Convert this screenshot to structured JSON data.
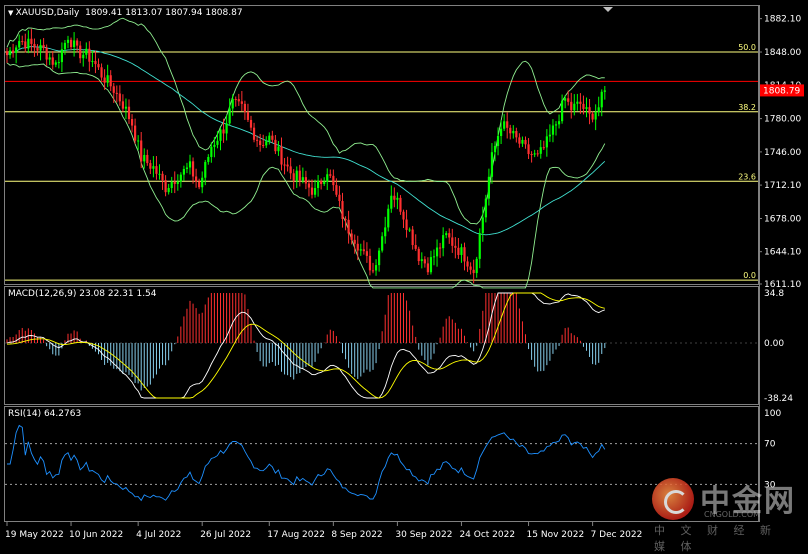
{
  "header": {
    "symbol": "XAUUSD,Daily",
    "ohlc": "1809.41 1813.07 1807.94 1808.87"
  },
  "panels": {
    "macd": {
      "title": "MACD(12,26,9) 23.08 22.31 1.54"
    },
    "rsi": {
      "title": "RSI(14) 64.2763"
    }
  },
  "watermark": {
    "brand": "中金网",
    "site": "CNGOLD.COM",
    "tagline": "中 文 财 经 新 媒 体"
  },
  "colors": {
    "background": "#000000",
    "grid_frame": "#808080",
    "bull_candle": "#00ff00",
    "bear_candle": "#ff3030",
    "bollinger": "#90ee90",
    "ma": "#40e0d0",
    "fib_line": "#ffff80",
    "current_price_line": "#ff0000",
    "macd_hist_pos": "#ff3030",
    "macd_hist_neg": "#87ceeb",
    "macd_line": "#ffffff",
    "signal_line": "#ffff00",
    "rsi_line": "#1e90ff"
  },
  "chart_data": [
    {
      "type": "candlestick",
      "title": "XAUUSD,Daily",
      "ylim": [
        1611.1,
        1895
      ],
      "y_ticks": [
        "1882.10",
        "1848.00",
        "1814.10",
        "1780.00",
        "1746.00",
        "1712.10",
        "1678.00",
        "1644.10",
        "1611.10"
      ],
      "current_price": "1808.79",
      "current_price_value": 1808.79,
      "fib_levels": [
        {
          "label": "50.0",
          "value": 1848.0
        },
        {
          "label": "38.2",
          "value": 1787.0
        },
        {
          "label": "23.6",
          "value": 1716.0
        },
        {
          "label": "0.0",
          "value": 1615.0
        }
      ],
      "resistance_value": 1818.0,
      "x_labels": [
        "19 May 2022",
        "10 Jun 2022",
        "4 Jul 2022",
        "26 Jul 2022",
        "17 Aug 2022",
        "8 Sep 2022",
        "30 Sep 2022",
        "24 Oct 2022",
        "15 Nov 2022",
        "7 Dec 2022"
      ],
      "close_keypoints": [
        [
          0,
          1845
        ],
        [
          4,
          1860
        ],
        [
          8,
          1855
        ],
        [
          12,
          1850
        ],
        [
          16,
          1835
        ],
        [
          20,
          1865
        ],
        [
          23,
          1848
        ],
        [
          26,
          1845
        ],
        [
          28,
          1840
        ],
        [
          31,
          1825
        ],
        [
          35,
          1810
        ],
        [
          38,
          1795
        ],
        [
          41,
          1775
        ],
        [
          44,
          1740
        ],
        [
          48,
          1730
        ],
        [
          52,
          1710
        ],
        [
          56,
          1722
        ],
        [
          60,
          1730
        ],
        [
          63,
          1710
        ],
        [
          67,
          1752
        ],
        [
          71,
          1770
        ],
        [
          74,
          1795
        ],
        [
          77,
          1790
        ],
        [
          80,
          1770
        ],
        [
          83,
          1755
        ],
        [
          86,
          1760
        ],
        [
          89,
          1745
        ],
        [
          93,
          1725
        ],
        [
          97,
          1715
        ],
        [
          101,
          1705
        ],
        [
          105,
          1728
        ],
        [
          108,
          1700
        ],
        [
          111,
          1672
        ],
        [
          114,
          1658
        ],
        [
          117,
          1640
        ],
        [
          120,
          1625
        ],
        [
          123,
          1660
        ],
        [
          126,
          1705
        ],
        [
          129,
          1690
        ],
        [
          132,
          1665
        ],
        [
          135,
          1640
        ],
        [
          138,
          1630
        ],
        [
          141,
          1645
        ],
        [
          144,
          1660
        ],
        [
          147,
          1650
        ],
        [
          150,
          1640
        ],
        [
          153,
          1625
        ],
        [
          156,
          1680
        ],
        [
          159,
          1740
        ],
        [
          162,
          1775
        ],
        [
          165,
          1765
        ],
        [
          168,
          1755
        ],
        [
          171,
          1745
        ],
        [
          174,
          1740
        ],
        [
          177,
          1755
        ],
        [
          180,
          1775
        ],
        [
          183,
          1800
        ],
        [
          185,
          1790
        ],
        [
          188,
          1795
        ],
        [
          191,
          1782
        ],
        [
          194,
          1792
        ],
        [
          196,
          1809
        ]
      ]
    },
    {
      "type": "bar",
      "title": "MACD(12,26,9) 23.08 22.31 1.54",
      "ylim": [
        -38.24,
        34.8
      ],
      "y_ticks": [
        "34.8",
        "0.00",
        "-38.24"
      ],
      "macd": 23.08,
      "signal": 22.31,
      "histogram": 1.54
    },
    {
      "type": "line",
      "title": "RSI(14) 64.2763",
      "ylim": [
        0,
        100
      ],
      "y_ticks": [
        "100",
        "70",
        "30"
      ],
      "levels": [
        70,
        30
      ],
      "rsi": 64.2763
    }
  ]
}
